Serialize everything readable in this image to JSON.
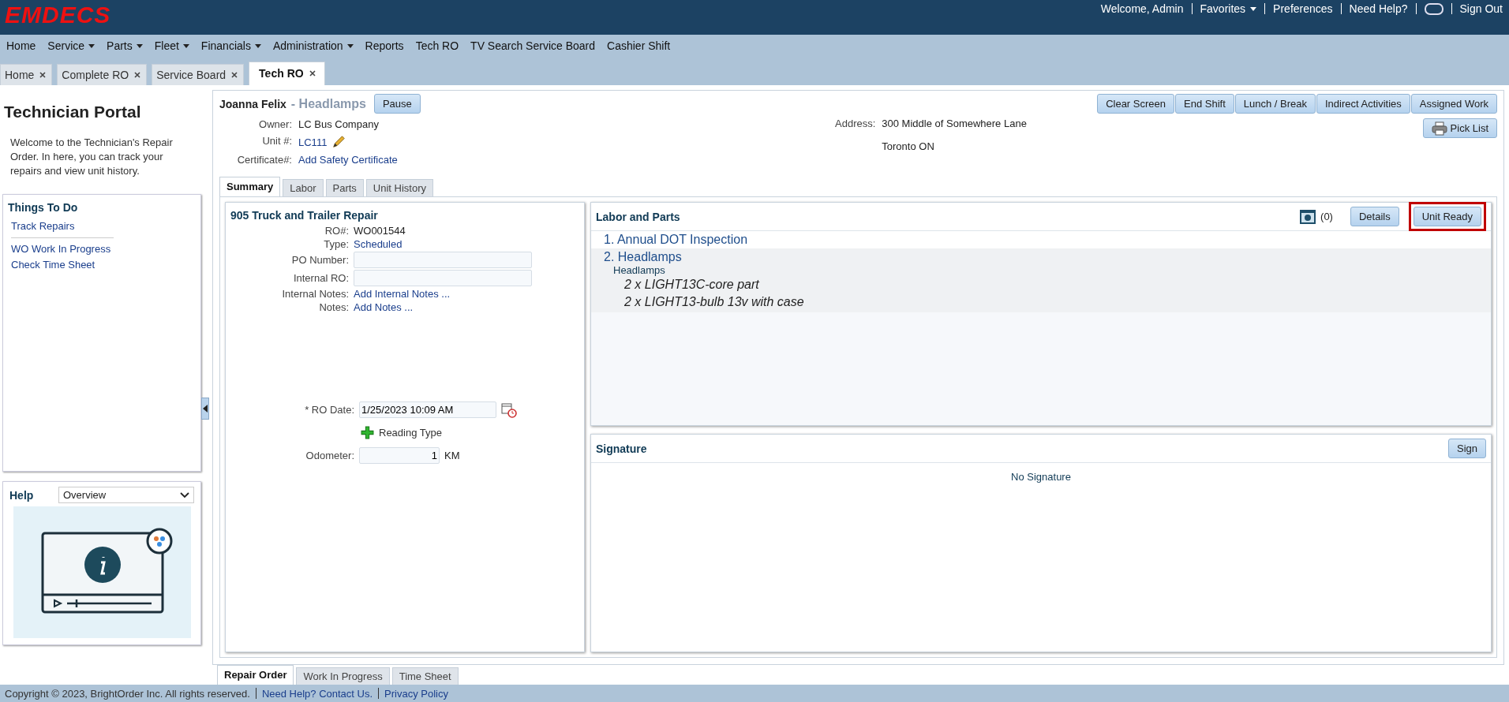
{
  "header": {
    "logo": "EMDECS",
    "links": [
      {
        "kind": "text",
        "label": "Welcome, Admin"
      },
      {
        "kind": "menu",
        "label": "Favorites"
      },
      {
        "kind": "link",
        "label": "Preferences"
      },
      {
        "kind": "link",
        "label": "Need Help?"
      },
      {
        "kind": "toggle"
      },
      {
        "kind": "link",
        "label": "Sign Out"
      }
    ]
  },
  "menu": [
    {
      "label": "Home",
      "dropdown": false
    },
    {
      "label": "Service",
      "dropdown": true
    },
    {
      "label": "Parts",
      "dropdown": true
    },
    {
      "label": "Fleet",
      "dropdown": true
    },
    {
      "label": "Financials",
      "dropdown": true
    },
    {
      "label": "Administration",
      "dropdown": true
    },
    {
      "label": "Reports",
      "dropdown": false
    },
    {
      "label": "Tech RO",
      "dropdown": false
    },
    {
      "label": "TV Search Service Board",
      "dropdown": false
    },
    {
      "label": "Cashier Shift",
      "dropdown": false
    }
  ],
  "tabs": [
    {
      "label": "Home",
      "selected": false
    },
    {
      "label": "Complete RO",
      "selected": false
    },
    {
      "label": "Service Board",
      "selected": false
    },
    {
      "label": "Tech RO",
      "selected": true
    }
  ],
  "sidebar": {
    "title": "Technician Portal",
    "intro": "Welcome to the Technician's Repair Order. In here, you can track your repairs and view unit history.",
    "things_to_do": {
      "title": "Things To Do",
      "items": [
        "Track Repairs",
        "WO Work In Progress",
        "Check Time Sheet"
      ]
    },
    "help": {
      "title": "Help",
      "select": "Overview"
    }
  },
  "work_order": {
    "technician": "Joanna Felix",
    "job": "- Headlamps",
    "pause": "Pause",
    "actions": [
      "Clear Screen",
      "End Shift",
      "Lunch / Break",
      "Indirect Activities",
      "Assigned Work"
    ],
    "pick_list": "Pick List",
    "owner": {
      "label": "Owner:",
      "value": "LC Bus Company"
    },
    "unit": {
      "label": "Unit #:",
      "value": "LC111"
    },
    "certificate": {
      "label": "Certificate#:",
      "value": "Add Safety Certificate"
    },
    "address": {
      "label": "Address:",
      "lines": [
        "300 Middle of Somewhere Lane",
        "Toronto ON"
      ]
    }
  },
  "detail_tabs": [
    {
      "label": "Summary",
      "selected": true
    },
    {
      "label": "Labor",
      "selected": false
    },
    {
      "label": "Parts",
      "selected": false
    },
    {
      "label": "Unit History",
      "selected": false
    }
  ],
  "summary": {
    "title": "905 Truck and Trailer Repair",
    "fields": [
      {
        "kind": "text",
        "label": "RO#:",
        "value": "WO001544"
      },
      {
        "kind": "link",
        "label": "Type:",
        "value": "Scheduled"
      },
      {
        "kind": "input",
        "label": "PO Number:"
      },
      {
        "kind": "input",
        "label": "Internal RO:"
      },
      {
        "kind": "link",
        "label": "Internal Notes:",
        "value": "Add Internal Notes ..."
      },
      {
        "kind": "link",
        "label": "Notes:",
        "value": "Add Notes ..."
      }
    ],
    "ro_date": {
      "label": "* RO Date:",
      "value": "1/25/2023 10:09 AM"
    },
    "reading_type": "Reading Type",
    "odometer": {
      "label": "Odometer:",
      "value": "1",
      "unit": "KM"
    }
  },
  "labor_parts": {
    "title": "Labor and Parts",
    "photo_count": "(0)",
    "buttons": [
      {
        "label": "Details",
        "highlighted": false
      },
      {
        "label": "Unit Ready",
        "highlighted": true
      }
    ],
    "jobs": [
      {
        "label": "1. Annual DOT Inspection",
        "selected": false
      },
      {
        "label": "2. Headlamps",
        "selected": true,
        "subtitle": "Headlamps",
        "parts": [
          "2 x LIGHT13C-core part",
          "2 x LIGHT13-bulb 13v with case"
        ]
      }
    ]
  },
  "signature": {
    "title": "Signature",
    "button": "Sign",
    "status": "No Signature"
  },
  "bottom_tabs": [
    {
      "label": "Repair Order",
      "selected": true
    },
    {
      "label": "Work In Progress",
      "selected": false
    },
    {
      "label": "Time Sheet",
      "selected": false
    }
  ],
  "footer": {
    "copyright": "Copyright © 2023, BrightOrder Inc. All rights reserved.",
    "links": [
      "Need Help? Contact Us.",
      "Privacy Policy"
    ]
  }
}
